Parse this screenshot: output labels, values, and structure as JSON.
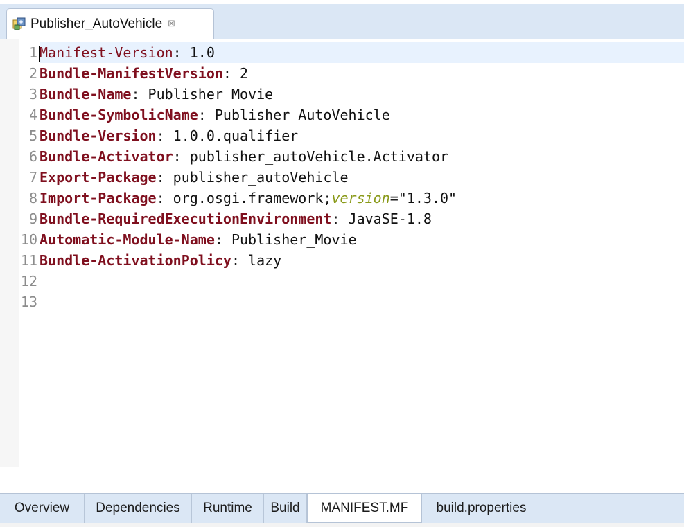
{
  "editor_tab": {
    "title": "Publisher_AutoVehicle",
    "close_symbol": "⊠",
    "icon": "plugin-manifest-icon"
  },
  "lines": [
    {
      "n": "1",
      "key": "Manifest-Version",
      "key_style": "plain",
      "sep": ": ",
      "value": "1.0"
    },
    {
      "n": "2",
      "key": "Bundle-ManifestVersion",
      "key_style": "bold",
      "sep": ": ",
      "value": "2"
    },
    {
      "n": "3",
      "key": "Bundle-Name",
      "key_style": "bold",
      "sep": ": ",
      "value": "Publisher_Movie"
    },
    {
      "n": "4",
      "key": "Bundle-SymbolicName",
      "key_style": "bold",
      "sep": ": ",
      "value": "Publisher_AutoVehicle"
    },
    {
      "n": "5",
      "key": "Bundle-Version",
      "key_style": "bold",
      "sep": ": ",
      "value": "1.0.0.qualifier"
    },
    {
      "n": "6",
      "key": "Bundle-Activator",
      "key_style": "bold",
      "sep": ": ",
      "value": "publisher_autoVehicle.Activator"
    },
    {
      "n": "7",
      "key": "Export-Package",
      "key_style": "bold",
      "sep": ": ",
      "value": "publisher_autoVehicle"
    },
    {
      "n": "8",
      "key": "Import-Package",
      "key_style": "bold",
      "sep": ": ",
      "value": "org.osgi.framework;",
      "attr": "version",
      "attr_eq": "=",
      "attr_value": "\"1.3.0\""
    },
    {
      "n": "9",
      "key": "Bundle-RequiredExecutionEnvironment",
      "key_style": "bold",
      "sep": ": ",
      "value": "JavaSE-1.8"
    },
    {
      "n": "10",
      "key": "Automatic-Module-Name",
      "key_style": "bold",
      "sep": ": ",
      "value": "Publisher_Movie"
    },
    {
      "n": "11",
      "key": "Bundle-ActivationPolicy",
      "key_style": "bold",
      "sep": ": ",
      "value": "lazy"
    },
    {
      "n": "12",
      "key": "",
      "key_style": "bold",
      "sep": "",
      "value": ""
    },
    {
      "n": "13",
      "key": "",
      "key_style": "bold",
      "sep": "",
      "value": ""
    }
  ],
  "scroll": {
    "left_arrow": "<"
  },
  "bottom_tabs": [
    {
      "label": "Overview",
      "active": false
    },
    {
      "label": "Dependencies",
      "active": false
    },
    {
      "label": "Runtime",
      "active": false
    },
    {
      "label": "Build",
      "active": false
    },
    {
      "label": "MANIFEST.MF",
      "active": true
    },
    {
      "label": "build.properties",
      "active": false
    }
  ],
  "colors": {
    "key": "#7f0f1e",
    "attribute": "#8a9a1a",
    "tab_bar": "#dbe7f5",
    "current_line": "#e8f2fe",
    "line_number": "#8c8c8c"
  }
}
